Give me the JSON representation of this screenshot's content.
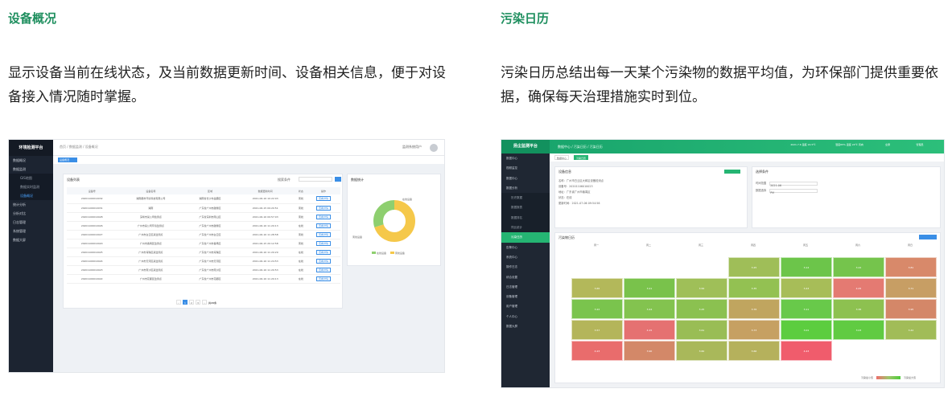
{
  "left": {
    "heading": "设备概况",
    "description": "显示设备当前在线状态，及当前数据更新时间、设备相关信息，便于对设备接入情况随时掌握。",
    "screenshot": {
      "logo": "环境检测平台",
      "menu": [
        {
          "label": "数据概况",
          "type": "item"
        },
        {
          "label": "数据监测",
          "type": "item"
        },
        {
          "label": "GIS地图",
          "type": "sub"
        },
        {
          "label": "数据实时监测",
          "type": "sub"
        },
        {
          "label": "设备概况",
          "type": "sub",
          "active": true
        },
        {
          "label": "统计分析",
          "type": "item"
        },
        {
          "label": "分析对比",
          "type": "item"
        },
        {
          "label": "日志管理",
          "type": "item"
        },
        {
          "label": "系统管理",
          "type": "item"
        },
        {
          "label": "数据大屏",
          "type": "item"
        }
      ],
      "breadcrumb": "首页 / 数据监测 / 设备概况",
      "user": "监测系统用户",
      "tab": "设备概况",
      "card_title": "设备列表",
      "search_label": "搜索条件",
      "columns": [
        "设备号",
        "设备名称",
        "区域",
        "数据更新时间",
        "状态",
        "操作"
      ],
      "rows": [
        [
          "20201106010032",
          "湖南都市环境科技有限公司",
          "湖南省长沙市岳麓区",
          "2021-06-16 10:22:03",
          "离线",
          "查看详情"
        ],
        [
          "20201106010031",
          "湖南",
          "广东省广州市越秀区",
          "2021-06-15 09:20:51",
          "离线",
          "查看详情"
        ],
        [
          "20201106010028",
          "深圳市某公司检测点",
          "广东省深圳市南山区",
          "2021-06-16 09:57:03",
          "离线",
          "查看详情"
        ],
        [
          "20201106010026",
          "广州市某公司环境监测点",
          "广东省广州市越秀区",
          "2021-06-16 11:20:13",
          "在线",
          "查看详情"
        ],
        [
          "20201106010027",
          "广州市白云区某监测点",
          "广东省广州市白云区",
          "2021-06-16 11:28:58",
          "离线",
          "查看详情"
        ],
        [
          "20201106010020",
          "广州市番禺区监测点",
          "广东省广州市番禺区",
          "2021-06-15 20:12:58",
          "离线",
          "查看详情"
        ],
        [
          "20201106010025",
          "广州市海珠区某监测点",
          "广东省广州市海珠区",
          "2021-06-16 11:20:29",
          "在线",
          "查看详情"
        ],
        [
          "20201106010024",
          "广州市天河区某监测点",
          "广东省广州市天河区",
          "2021-06-16 11:24:53",
          "在线",
          "查看详情"
        ],
        [
          "20201106010023",
          "广州市南沙区某监测点",
          "广东省广州市南沙区",
          "2021-06-16 11:20:53",
          "在线",
          "查看详情"
        ],
        [
          "20201106010022",
          "广州市花都区监测点",
          "广东省广州市花都区",
          "2021-06-16 11:20:13",
          "在线",
          "查看详情"
        ]
      ],
      "pager": {
        "pages": [
          "1",
          "2",
          "3"
        ],
        "current": "1",
        "total": "共20条"
      },
      "pie_title": "数据统计",
      "pie_legend": [
        "在线设备",
        "离线设备"
      ],
      "pie_labels": [
        "在线设备",
        "离线设备"
      ],
      "pie_values": {
        "online": 30,
        "offline": 70
      },
      "colors": {
        "online": "#8ecf6f",
        "offline": "#f5c84a",
        "accent": "#3a8ee6"
      }
    }
  },
  "right": {
    "heading": "污染日历",
    "description": "污染日历总结出每一天某个污染物的数据平均值，为环保部门提供重要依据，确保每天治理措施实时到位。",
    "screenshot": {
      "logo": "扬尘监测平台",
      "breadcrumb": "数据中心 / 污染日历 / 污染日历",
      "top_stats": [
        "2021.7.6 温度 24.5℃",
        "湿度65% 温度 24℃ 风向",
        "全屏",
        "管理员"
      ],
      "menu": [
        {
          "label": "数据中心",
          "type": "item"
        },
        {
          "label": "视频监控",
          "type": "item"
        },
        {
          "label": "数据中心",
          "type": "item"
        },
        {
          "label": "数据分析",
          "type": "item"
        },
        {
          "label": "历史数据",
          "type": "sub"
        },
        {
          "label": "数据报表",
          "type": "sub"
        },
        {
          "label": "数据排名",
          "type": "sub"
        },
        {
          "label": "同比统计",
          "type": "sub"
        },
        {
          "label": "污染日历",
          "type": "sub",
          "active": true
        },
        {
          "label": "告警中心",
          "type": "item"
        },
        {
          "label": "系统中心",
          "type": "item"
        },
        {
          "label": "操作日志",
          "type": "item"
        },
        {
          "label": "综合设置",
          "type": "item"
        },
        {
          "label": "日志管理",
          "type": "item"
        },
        {
          "label": "设备管理",
          "type": "item"
        },
        {
          "label": "用户管理",
          "type": "item"
        },
        {
          "label": "个人中心",
          "type": "item"
        },
        {
          "label": "数据大屏",
          "type": "item"
        }
      ],
      "tabs": [
        "数据中心",
        "污染日历"
      ],
      "box1_title": "设备信息",
      "box1_info": [
        "名称：广州市白云区大和区设备检测点",
        "设备号：20201106010023",
        "地址：广东省广州市番禺区",
        "状态：在线",
        "更新时间：2021-07-06 09:54:56"
      ],
      "box2_title": "选择条件",
      "box2_form": [
        {
          "label": "时间范围",
          "value": "2021-06"
        },
        {
          "label": "数据选择",
          "value": "PM"
        }
      ],
      "grid_title": "污染物日历",
      "weekdays": [
        "周一",
        "周二",
        "周三",
        "周四",
        "周五",
        "周六",
        "周日"
      ],
      "calendar": [
        [
          null,
          null,
          null,
          {
            "v": "3.25",
            "c": "#9fbe58"
          },
          {
            "v": "3.14",
            "c": "#6cc54a"
          },
          {
            "v": "3.22",
            "c": "#75c44c"
          },
          {
            "v": "3.81",
            "c": "#d8896a"
          }
        ],
        [
          {
            "v": "3.65",
            "c": "#b3b85a"
          },
          {
            "v": "3.21",
            "c": "#79c24b"
          },
          {
            "v": "3.56",
            "c": "#9fbf58"
          },
          {
            "v": "3.35",
            "c": "#93c152"
          },
          {
            "v": "3.43",
            "c": "#a7bd58"
          },
          {
            "v": "4.05",
            "c": "#e47a72"
          },
          {
            "v": "3.71",
            "c": "#c79e64"
          }
        ],
        [
          {
            "v": "3.22",
            "c": "#7ac44d"
          },
          {
            "v": "3.44",
            "c": "#83c34f"
          },
          {
            "v": "3.25",
            "c": "#8bc150"
          },
          {
            "v": "3.76",
            "c": "#c0a55f"
          },
          {
            "v": "3.11",
            "c": "#68c94a"
          },
          {
            "v": "3.36",
            "c": "#8dc150"
          },
          {
            "v": "3.95",
            "c": "#d48768"
          }
        ],
        [
          {
            "v": "3.57",
            "c": "#b4b55a"
          },
          {
            "v": "4.15",
            "c": "#e57171"
          },
          {
            "v": "3.61",
            "c": "#99bd55"
          },
          {
            "v": "3.73",
            "c": "#c6a062"
          },
          {
            "v": "3.01",
            "c": "#5ccd3f"
          },
          {
            "v": "3.03",
            "c": "#60cb42"
          },
          {
            "v": "3.42",
            "c": "#a1bc58"
          }
        ],
        [
          {
            "v": "4.23",
            "c": "#e96c6c"
          },
          {
            "v": "3.90",
            "c": "#d38868"
          },
          {
            "v": "3.60",
            "c": "#a9b85a"
          },
          {
            "v": "3.66",
            "c": "#b5b15c"
          },
          {
            "v": "4.43",
            "c": "#f05c6c"
          },
          null,
          null
        ]
      ],
      "legend": [
        "污染最小值",
        "污染最大值"
      ]
    }
  }
}
